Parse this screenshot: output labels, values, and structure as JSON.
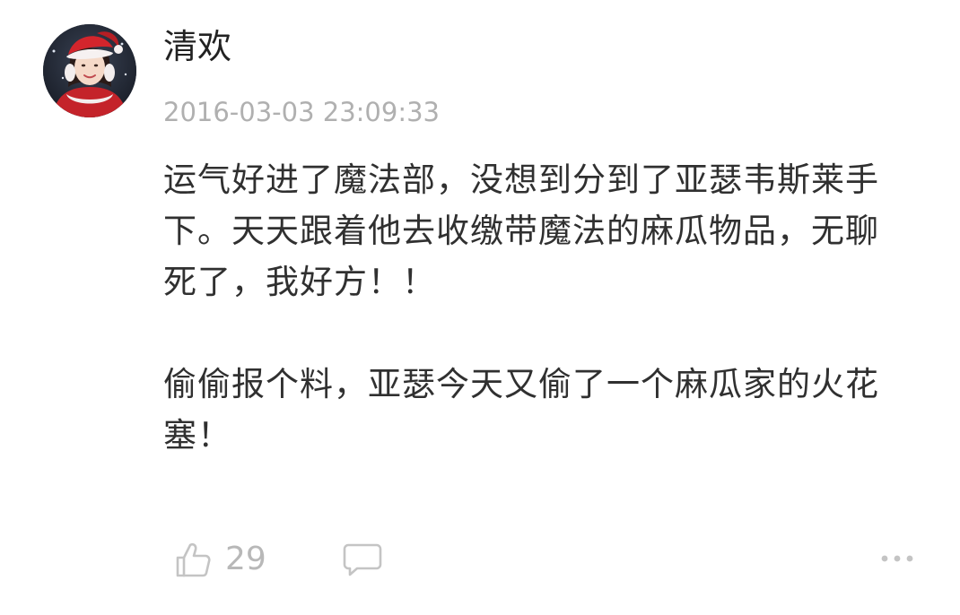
{
  "comment": {
    "username": "清欢",
    "timestamp": "2016-03-03 23:09:33",
    "paragraphs": [
      "运气好进了魔法部，没想到分到了亚瑟韦斯莱手下。天天跟着他去收缴带魔法的麻瓜物品，无聊死了，我好方！！",
      "偷偷报个料，亚瑟今天又偷了一个麻瓜家的火花塞！"
    ],
    "likes": "29"
  },
  "icons": {
    "avatar": "user-avatar",
    "like": "thumbs-up-icon",
    "reply": "speech-bubble-icon",
    "more": "more-dots-icon"
  },
  "colors": {
    "text": "#303030",
    "muted": "#b0b0b0",
    "icon": "#c4c4c4"
  }
}
